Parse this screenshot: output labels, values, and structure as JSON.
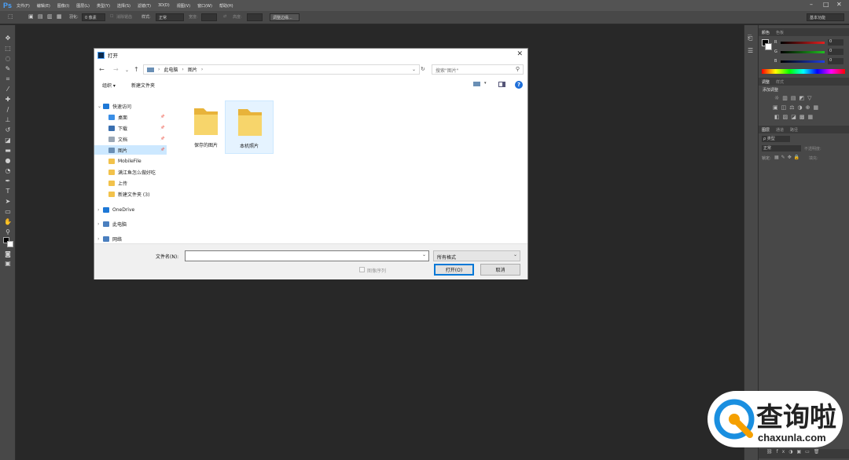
{
  "app": {
    "logo": "Ps"
  },
  "menu": [
    "文件(F)",
    "编辑(E)",
    "图像(I)",
    "图层(L)",
    "类型(Y)",
    "选择(S)",
    "滤镜(T)",
    "3D(D)",
    "视图(V)",
    "窗口(W)",
    "帮助(H)"
  ],
  "options_bar": {
    "feather_label": "羽化:",
    "feather_value": "0 像素",
    "antialias_label": "消除锯齿",
    "style_label": "样式:",
    "style_value": "正常",
    "width_label": "宽度:",
    "height_label": "高度:",
    "refine_edge_label": "调整边缘...",
    "workspace_value": "基本功能"
  },
  "right_panel": {
    "color_tabs": [
      "颜色",
      "色板"
    ],
    "color_values": {
      "r": "0",
      "g": "0",
      "b": "0"
    },
    "adjust_tabs": [
      "调整",
      "样式"
    ],
    "adjust_title": "添加调整",
    "layer_tabs": [
      "图层",
      "通道",
      "路径"
    ],
    "layer_filter": "ρ 类型",
    "blend_mode": "正常",
    "opacity_label": "不透明度:",
    "lock_label": "锁定:",
    "fill_label": "填充:"
  },
  "dialog": {
    "title": "打开",
    "path": [
      "此电脑",
      "图片"
    ],
    "search_placeholder": "搜索\"图片\"",
    "organize_label": "组织 ▾",
    "new_folder_label": "新建文件夹",
    "nav": [
      {
        "label": "快速访问",
        "kind": "star",
        "level": 0,
        "expanded": true
      },
      {
        "label": "桌面",
        "kind": "desktop",
        "level": 1,
        "pin": true
      },
      {
        "label": "下载",
        "kind": "download",
        "level": 1,
        "pin": true
      },
      {
        "label": "文档",
        "kind": "doc",
        "level": 1,
        "pin": true
      },
      {
        "label": "图片",
        "kind": "pic",
        "level": 1,
        "pin": true,
        "selected": true
      },
      {
        "label": "MobileFile",
        "kind": "folder",
        "level": 1
      },
      {
        "label": "满江鱼怎么做好吃",
        "kind": "folder",
        "level": 1
      },
      {
        "label": "上传",
        "kind": "folder",
        "level": 1
      },
      {
        "label": "新建文件夹 (3)",
        "kind": "folder",
        "level": 1
      },
      {
        "label": "OneDrive",
        "kind": "cloud",
        "level": 0
      },
      {
        "label": "此电脑",
        "kind": "pc",
        "level": 0
      },
      {
        "label": "网络",
        "kind": "network",
        "level": 0
      }
    ],
    "files": [
      {
        "label": "保存的图片",
        "selected": false
      },
      {
        "label": "本机照片",
        "selected": true
      }
    ],
    "filename_label": "文件名(N):",
    "filename_value": "",
    "filetype_value": "所有格式",
    "image_sequence_label": "图像序列",
    "open_label": "打开(O)",
    "cancel_label": "取消"
  },
  "watermark": {
    "brand": "查询啦",
    "domain": "chaxunla.com"
  }
}
